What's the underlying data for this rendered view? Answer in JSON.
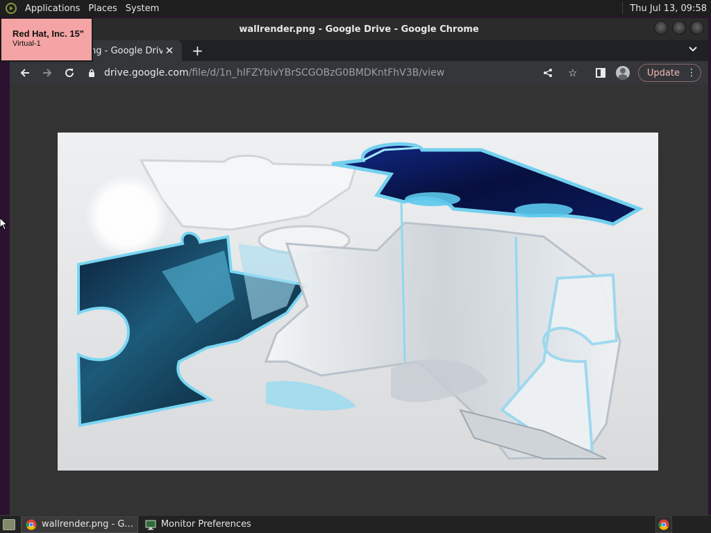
{
  "top_panel": {
    "menus": [
      "Applications",
      "Places",
      "System"
    ],
    "clock": "Thu Jul 13, 09:58"
  },
  "monitor_label": {
    "name": "Red Hat, Inc. 15\"",
    "connector": "Virtual-1"
  },
  "window": {
    "title": "wallrender.png - Google Drive - Google Chrome"
  },
  "tab": {
    "title": "wallrender.png - Google Drive",
    "visible_title": "ng - Google Drive"
  },
  "toolbar": {
    "url_host": "drive.google.com",
    "url_path": "/file/d/1n_hIFZYbivYBrSCGOBzG0BMDKntFhV3B/view",
    "update_label": "Update"
  },
  "viewer": {
    "image_alt": "wallrender.png"
  },
  "taskbar": {
    "items": [
      {
        "label": "wallrender.png - G...",
        "icon": "chrome-icon",
        "active": true
      },
      {
        "label": "Monitor Preferences",
        "icon": "monitor-icon",
        "active": false
      }
    ]
  },
  "colors": {
    "panel_bg": "#1e1e1e",
    "chrome_toolbar": "#35363a",
    "update_text": "#f2b8b5",
    "monitor_label_bg": "#f4a4a4",
    "puzzle_dark": "#0a1a55",
    "puzzle_light_blue": "#6fd0f0"
  }
}
